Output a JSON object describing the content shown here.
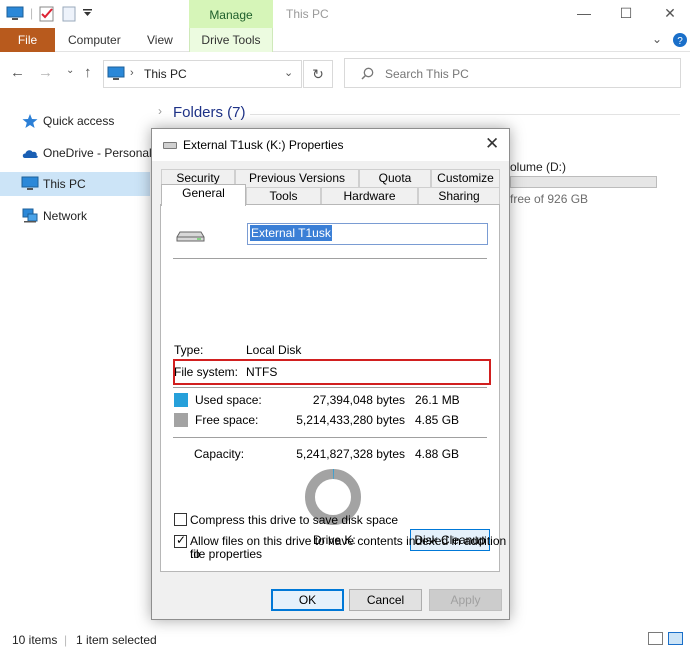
{
  "window": {
    "title": "This PC",
    "manage_tab": "Manage"
  },
  "ribbon": {
    "file": "File",
    "computer": "Computer",
    "view": "View",
    "drive_tools": "Drive Tools"
  },
  "address": {
    "path": "This PC",
    "search_placeholder": "Search This PC"
  },
  "nav": {
    "items": [
      {
        "label": "Quick access",
        "icon": "star-icon"
      },
      {
        "label": "OneDrive - Personal",
        "icon": "cloud-icon"
      },
      {
        "label": "This PC",
        "icon": "computer-icon",
        "selected": true
      },
      {
        "label": "Network",
        "icon": "network-icon"
      }
    ]
  },
  "content": {
    "folders_heading": "Folders (7)",
    "volume_label": "olume (D:)",
    "volume_free": "free of 926 GB"
  },
  "status": {
    "items": "10 items",
    "selected": "1 item selected"
  },
  "dialog": {
    "title": "External T1usk (K:) Properties",
    "tabs_row1": [
      "Security",
      "Previous Versions",
      "Quota",
      "Customize"
    ],
    "tabs_row2": [
      "General",
      "Tools",
      "Hardware",
      "Sharing"
    ],
    "active_tab": "General",
    "drive_name": "External T1usk",
    "type_label": "Type:",
    "type_value": "Local Disk",
    "fs_label": "File system:",
    "fs_value": "NTFS",
    "used_label": "Used space:",
    "used_bytes": "27,394,048 bytes",
    "used_size": "26.1 MB",
    "free_label": "Free space:",
    "free_bytes": "5,214,433,280 bytes",
    "free_size": "4.85 GB",
    "capacity_label": "Capacity:",
    "capacity_bytes": "5,241,827,328 bytes",
    "capacity_size": "4.88 GB",
    "used_fraction": 0.0052,
    "drive_letter_label": "Drive K:",
    "disk_cleanup": "Disk Cleanup",
    "compress_label": "Compress this drive to save disk space",
    "compress_checked": false,
    "index_label_line1": "Allow files on this drive to have contents indexed in addition to",
    "index_label_line2": "file properties",
    "index_checked": true,
    "ok": "OK",
    "cancel": "Cancel",
    "apply": "Apply",
    "colors": {
      "used": "#26a0da",
      "free": "#a3a3a3",
      "highlight": "#d11f1f"
    }
  }
}
